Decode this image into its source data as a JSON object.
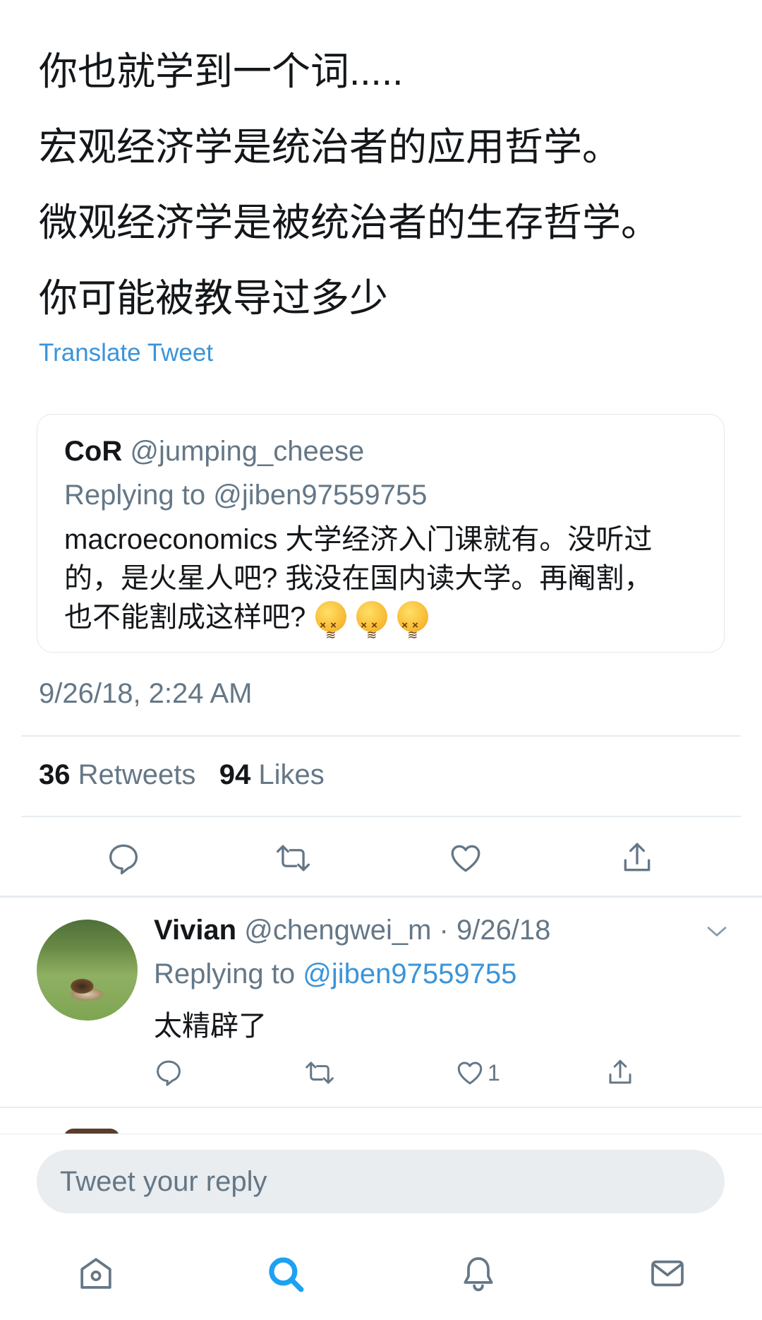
{
  "tweet": {
    "lines": [
      "你也就学到一个词.....",
      "宏观经济学是统治者的应用哲学。",
      "微观经济学是被统治者的生存哲学。",
      "你可能被教导过多少"
    ],
    "translate_label": "Translate Tweet",
    "timestamp": "9/26/18, 2:24 AM"
  },
  "quoted": {
    "name": "CoR",
    "handle": "@jumping_cheese",
    "replying_to": "Replying to @jiben97559755",
    "body_lines": [
      "macroeconomics 大学经济入门课就有。没听过",
      "的，是火星人吧? 我没在国内读大学。再阉割，",
      "也不能割成这样吧?"
    ],
    "emoji_names": [
      "confounded-face",
      "confounded-face",
      "confounded-face"
    ]
  },
  "stats": {
    "retweets_count": "36",
    "retweets_label": "Retweets",
    "likes_count": "94",
    "likes_label": "Likes"
  },
  "action_icons": [
    "reply-icon",
    "retweet-icon",
    "like-icon",
    "share-icon"
  ],
  "reply": {
    "name": "Vivian",
    "meta": "@chengwei_m · 9/26/18",
    "replying_prefix": "Replying to",
    "replying_handle": "@jiben97559755",
    "body": "太精辟了",
    "like_count": "1"
  },
  "compose": {
    "placeholder": "Tweet your reply"
  },
  "tab_bar": [
    "home-icon",
    "search-icon",
    "notifications-icon",
    "messages-icon"
  ],
  "colors": {
    "link_blue": "#3b94d9",
    "active_tab_blue": "#1da1f2",
    "text_primary": "#14171a",
    "text_secondary": "#657786",
    "divider": "#e6ecf0",
    "compose_bg": "#e9edf0"
  }
}
